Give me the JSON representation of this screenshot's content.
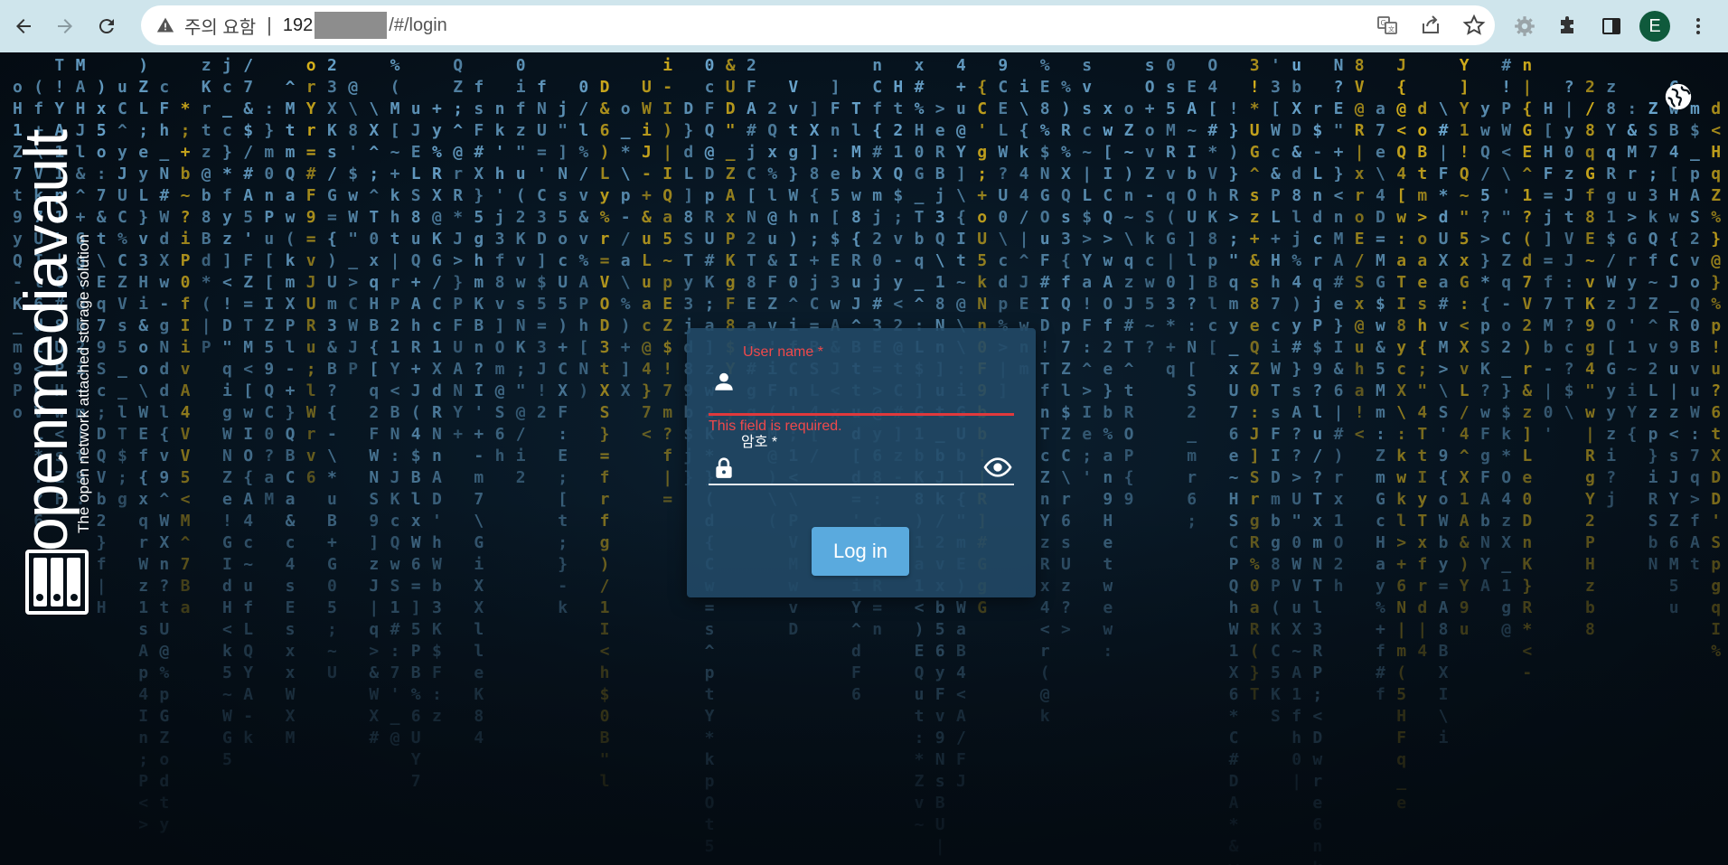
{
  "browser": {
    "security_label": "주의 요함",
    "url_host": "192",
    "url_path": "/#/login",
    "profile_initial": "E",
    "icons": [
      "back-icon",
      "forward-icon",
      "reload-icon",
      "warning-icon",
      "translate-icon",
      "share-icon",
      "star-icon",
      "extension-gear-icon",
      "puzzle-icon",
      "sidepanel-icon",
      "kebab-menu-icon"
    ]
  },
  "brand": {
    "name": "openmediavault",
    "tagline": "The open network attached storage solution"
  },
  "login": {
    "username_label": "User name *",
    "username_error": "This field is required.",
    "password_label": "암호 *",
    "username_value": "",
    "password_value": "",
    "submit_label": "Log in"
  },
  "colors": {
    "error": "#f0494b",
    "button": "#5aaade",
    "dialog": "#224a68",
    "matrix_blue": "#6aa6cf",
    "matrix_yellow": "#d8b21c"
  }
}
